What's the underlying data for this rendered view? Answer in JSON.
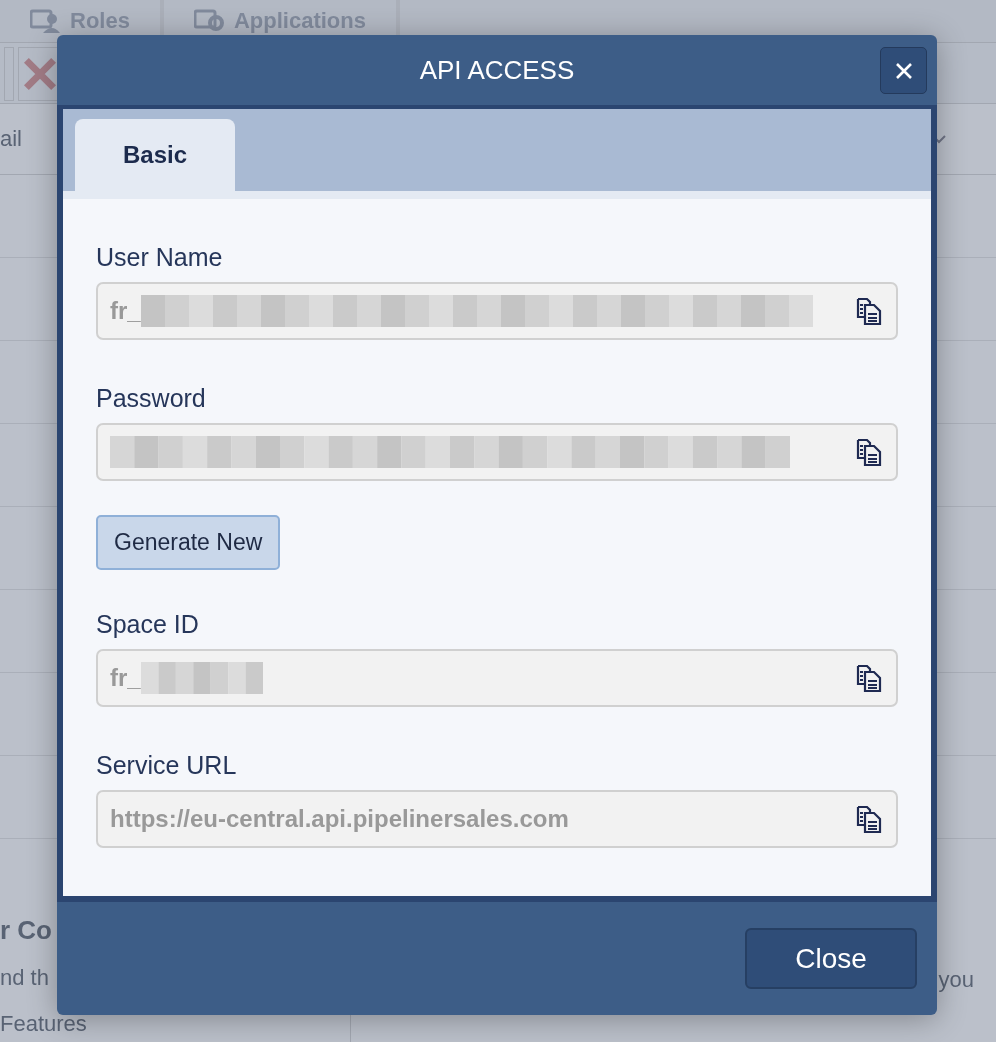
{
  "background": {
    "tabs": [
      "Roles",
      "Applications"
    ],
    "column_header": "ail",
    "left_texts": [
      "r Co",
      "nd th",
      "Features"
    ],
    "right_text": "you"
  },
  "dialog": {
    "title": "API ACCESS",
    "tabs": [
      {
        "label": "Basic",
        "selected": true
      }
    ],
    "items": [
      {
        "kind": "field",
        "label": "User Name",
        "value": "fr_",
        "redacted": true
      },
      {
        "kind": "field",
        "label": "Password",
        "value": "",
        "redacted": true
      },
      {
        "kind": "button",
        "label": "Generate New"
      },
      {
        "kind": "field",
        "label": "Space ID",
        "value": "fr_",
        "redacted": true
      },
      {
        "kind": "field",
        "label": "Service URL",
        "value": "https://eu-central.api.pipelinersales.com",
        "redacted": false
      }
    ],
    "footer_button": "Close"
  }
}
